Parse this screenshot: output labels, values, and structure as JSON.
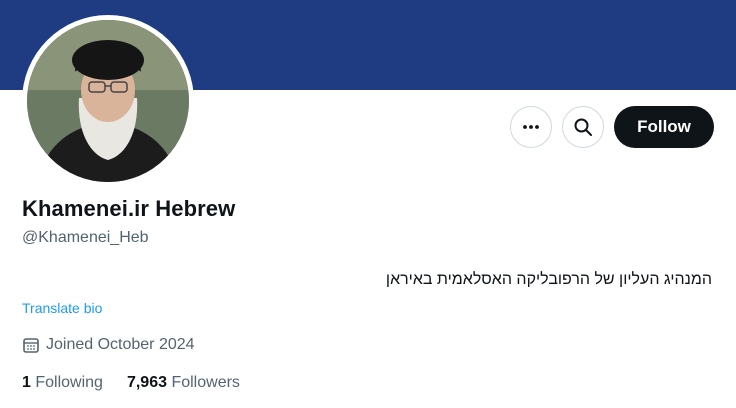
{
  "banner": {
    "color": "#1f3b82"
  },
  "profile": {
    "display_name": "Khamenei.ir Hebrew",
    "handle": "@Khamenei_Heb",
    "bio": "המנהיג העליון של הרפובליקה האסלאמית באיראן",
    "translate_label": "Translate bio",
    "joined": "Joined October 2024"
  },
  "actions": {
    "more_icon": "more-horizontal-icon",
    "search_icon": "search-icon",
    "follow_label": "Follow"
  },
  "stats": {
    "following_count": "1",
    "following_label": "Following",
    "followers_count": "7,963",
    "followers_label": "Followers"
  },
  "colors": {
    "accent": "#1d9bf0",
    "text": "#0f1419",
    "muted": "#536471"
  }
}
